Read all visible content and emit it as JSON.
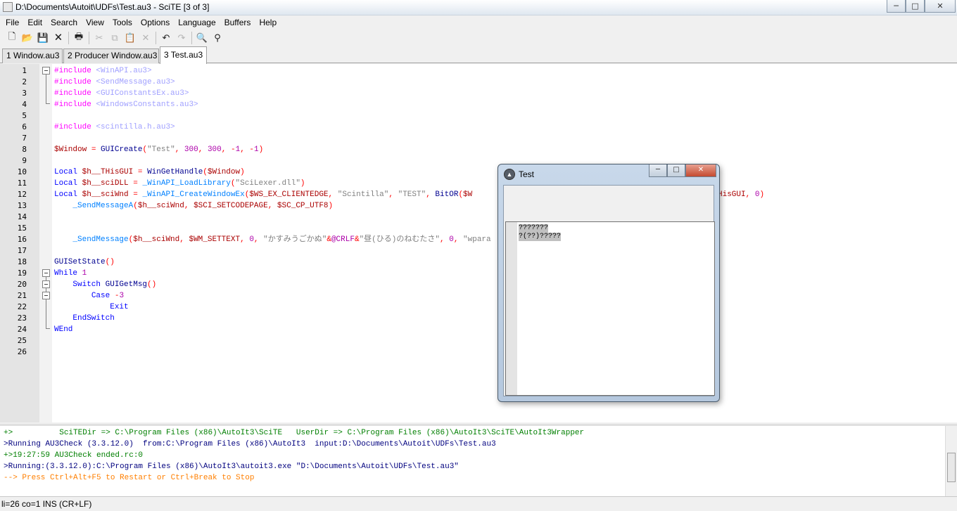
{
  "window": {
    "title": "D:\\Documents\\Autoit\\UDFs\\Test.au3 - SciTE [3 of 3]",
    "min": "─",
    "max": "□",
    "close": "✕"
  },
  "menu": [
    "File",
    "Edit",
    "Search",
    "View",
    "Tools",
    "Options",
    "Language",
    "Buffers",
    "Help"
  ],
  "toolbar": {
    "icons": [
      "new-file-icon",
      "open-folder-icon",
      "save-icon",
      "close-file-icon",
      "print-icon",
      "cut-icon",
      "copy-icon",
      "paste-icon",
      "delete-icon",
      "undo-icon",
      "redo-icon",
      "find-icon",
      "replace-icon"
    ],
    "glyphs": {
      "new": "🗋",
      "open": "📂",
      "save": "💾",
      "close": "🗙",
      "print": "🖶",
      "cut": "✂",
      "copy": "⧉",
      "paste": "📋",
      "delete": "✕",
      "undo": "↶",
      "redo": "↷",
      "find": "🔍",
      "replace": "⚲"
    }
  },
  "tabs": [
    {
      "label": "1 Window.au3",
      "active": false
    },
    {
      "label": "2 Producer Window.au3",
      "active": false
    },
    {
      "label": "3 Test.au3",
      "active": true
    }
  ],
  "editor": {
    "line_numbers": [
      "1",
      "2",
      "3",
      "4",
      "5",
      "6",
      "7",
      "8",
      "9",
      "10",
      "11",
      "12",
      "13",
      "14",
      "15",
      "16",
      "17",
      "18",
      "19",
      "20",
      "21",
      "22",
      "23",
      "24",
      "25",
      "26"
    ]
  },
  "output": {
    "lines": [
      {
        "text": "+>          SciTEDir => C:\\Program Files (x86)\\AutoIt3\\SciTE   UserDir => C:\\Program Files (x86)\\AutoIt3\\SciTE\\AutoIt3Wrapper",
        "style": "green"
      },
      {
        "text": ">Running AU3Check (3.3.12.0)  from:C:\\Program Files (x86)\\AutoIt3  input:D:\\Documents\\Autoit\\UDFs\\Test.au3",
        "style": "blue"
      },
      {
        "text": "+>19:27:59 AU3Check ended.rc:0",
        "style": "green"
      },
      {
        "text": ">Running:(3.3.12.0):C:\\Program Files (x86)\\AutoIt3\\autoit3.exe \"D:\\Documents\\Autoit\\UDFs\\Test.au3\"",
        "style": "blue"
      },
      {
        "text": "--> Press Ctrl+Alt+F5 to Restart or Ctrl+Break to Stop",
        "style": "orange"
      }
    ]
  },
  "status": "li=26 co=1 INS (CR+LF)",
  "dialog": {
    "title": "Test",
    "lines": [
      "???????",
      "?(??)?????"
    ]
  }
}
